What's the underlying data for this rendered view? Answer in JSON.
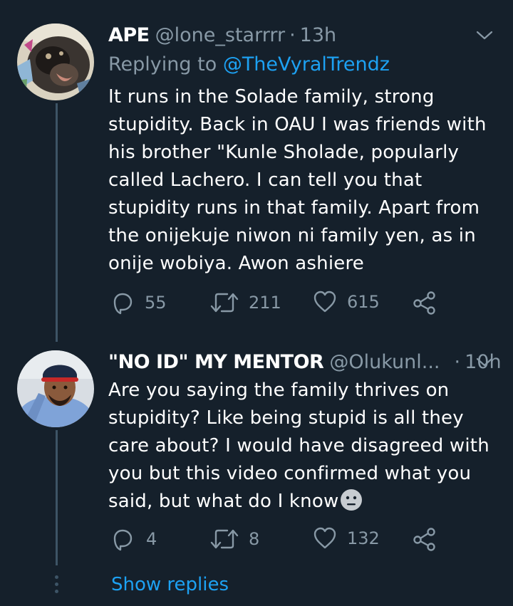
{
  "tweets": [
    {
      "display_name": "APE",
      "handle": "@lone_starrrr",
      "separator": "·",
      "time": "13h",
      "replying_prefix": "Replying to",
      "replying_to": "@TheVyralTrendz",
      "text": "It runs in the Solade family, strong stupidity. Back in OAU I was friends with his brother \"Kunle Sholade, popularly called Lachero. I can tell you that stupidity runs in that family. Apart from the onijekuje niwon ni family yen, as in onije wobiya. Awon ashiere",
      "replies": "55",
      "retweets": "211",
      "likes": "615",
      "avatar_icon": "gorilla-avatar"
    },
    {
      "display_name": "\"NO ID\" MY MENTOR",
      "handle": "@Olukunl...",
      "separator": "·",
      "time": "10h",
      "text": "Are you saying the family thrives on stupidity? Like being stupid is all they care about? I would have disagreed with you but this video confirmed what you said, but what do I know",
      "emoji": "neutral-face-emoji",
      "replies": "4",
      "retweets": "8",
      "likes": "132",
      "avatar_icon": "man-with-cap-avatar"
    }
  ],
  "show_replies_label": "Show replies",
  "colors": {
    "background": "#15202b",
    "text_primary": "#ffffff",
    "text_secondary": "#8899a6",
    "accent": "#1da1f2",
    "thread_line": "#3d5466"
  }
}
